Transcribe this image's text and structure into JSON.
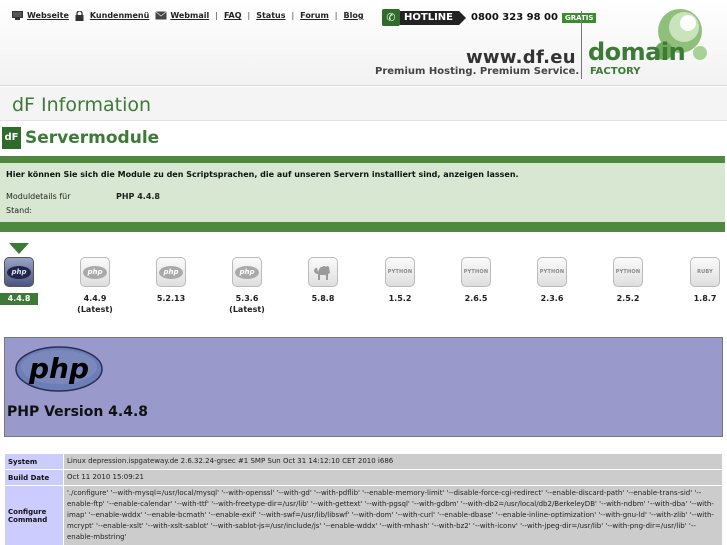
{
  "nav": {
    "links": [
      "Webseite",
      "Kundenmenü",
      "Webmail",
      "FAQ",
      "Status",
      "Forum",
      "Blog"
    ],
    "separator": "|"
  },
  "hotline": {
    "label": "HOTLINE",
    "number": "0800 323 98 00",
    "badge": "GRATIS"
  },
  "brand": {
    "url": "www.df.eu",
    "tagline": "Premium Hosting. Premium Service.",
    "logo_word": "domain",
    "logo_sub": "FACTORY"
  },
  "page": {
    "title": "dF Information"
  },
  "section": {
    "badge": "dF",
    "title": "Servermodule",
    "description": "Hier können Sie sich die Module zu den Scriptsprachen, die auf unseren Servern installiert sind, anzeigen lassen.",
    "details_label": "Moduldetails für",
    "details_value": "PHP 4.4.8",
    "stand_label": "Stand:"
  },
  "modules": [
    {
      "icon": "php",
      "version": "4.4.8",
      "sub": "",
      "active": true
    },
    {
      "icon": "php",
      "version": "4.4.9",
      "sub": "(Latest)",
      "active": false
    },
    {
      "icon": "php",
      "version": "5.2.13",
      "sub": "",
      "active": false
    },
    {
      "icon": "php",
      "version": "5.3.6",
      "sub": "(Latest)",
      "active": false
    },
    {
      "icon": "perl",
      "version": "5.8.8",
      "sub": "",
      "active": false
    },
    {
      "icon": "python",
      "version": "1.5.2",
      "sub": "",
      "active": false
    },
    {
      "icon": "python",
      "version": "2.6.5",
      "sub": "",
      "active": false
    },
    {
      "icon": "python",
      "version": "2.3.6",
      "sub": "",
      "active": false
    },
    {
      "icon": "python",
      "version": "2.5.2",
      "sub": "",
      "active": false
    },
    {
      "icon": "ruby",
      "version": "1.8.7",
      "sub": "",
      "active": false
    }
  ],
  "icon_labels": {
    "php": "php",
    "python": "PYTHON",
    "ruby": "RUBY"
  },
  "php_info": {
    "logo_text": "php",
    "version_title": "PHP Version 4.4.8",
    "rows": [
      {
        "key": "System",
        "value": "Linux depression.ispgateway.de 2.6.32.24-grsec #1 SMP Sun Oct 31 14:12:10 CET 2010 i686"
      },
      {
        "key": "Build Date",
        "value": "Oct 11 2010 15:09:21"
      },
      {
        "key": "Configure Command",
        "value": "'./configure' '--with-mysql=/usr/local/mysql' '--with-openssl' '--with-gd' '--with-pdflib' '--enable-memory-limit' '--disable-force-cgi-redirect' '--enable-discard-path' '--enable-trans-sid' '--enable-ftp' '--enable-calendar' '--with-ttf' '--with-freetype-dir=/usr/lib' '--with-gettext' '--with-pgsql' '--with-gdbm' '--with-db2=/usr/local/db2/BerkeleyDB' '--with-ndbm' '--with-dba' '--with-imap' '--enable-wddx' '--enable-bcmath' '--enable-exif' '--with-swf=/usr/lib/libswf' '--with-dom' '--with-curl' '--enable-dbase' '--enable-inline-optimization' '--with-gnu-ld' '--with-zlib' '--with-mcrypt' '--enable-xslt' '--with-xslt-sablot' '--with-sablot-js=/usr/include/js' '--enable-wddx' '--with-mhash' '--with-bz2' '--with-iconv' '--with-jpeg-dir=/usr/lib' '--with-png-dir=/usr/lib' '--enable-mbstring'"
      }
    ]
  },
  "colors": {
    "accent_green": "#3d7a37",
    "php_purple": "#9999cc",
    "table_key": "#ccccff",
    "table_value": "#cccccc"
  }
}
